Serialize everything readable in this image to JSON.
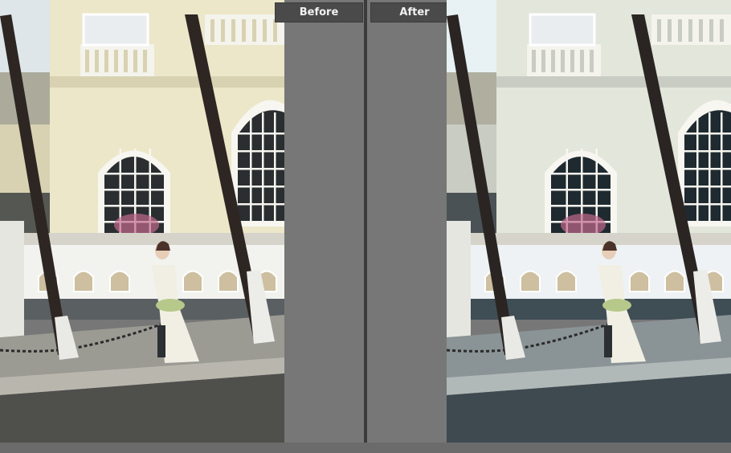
{
  "views": {
    "before": {
      "label": "Before",
      "tone": {
        "sky": "#dfe6ea",
        "wall": "#ece7c9",
        "wall_shade": "#d8d2b2",
        "lower_wall": "#f2f2ef",
        "sidewalk": "#9b9a93",
        "curb": "#b9b7ad",
        "road": "#4f4f4c",
        "trunk": "#2d2622",
        "window_dark": "#2a2e31",
        "base_band": "#5a5f62"
      }
    },
    "after": {
      "label": "After",
      "tone": {
        "sky": "#e8f1f4",
        "wall": "#e3e6da",
        "wall_shade": "#c9ccc2",
        "lower_wall": "#eef2f4",
        "sidewalk": "#8a9396",
        "curb": "#b1b8b8",
        "road": "#3e4a50",
        "trunk": "#2a2522",
        "window_dark": "#1f2a30",
        "base_band": "#3f4d55"
      }
    }
  }
}
